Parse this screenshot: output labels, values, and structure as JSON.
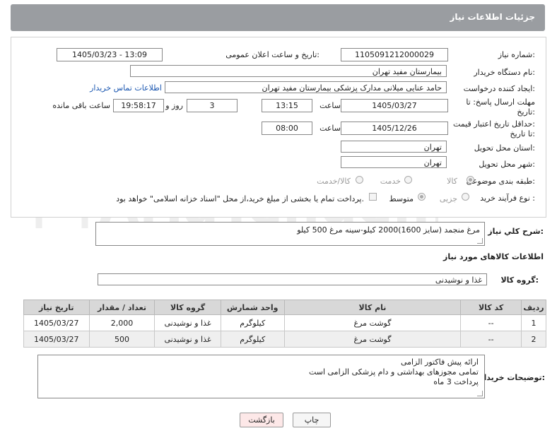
{
  "header": {
    "title": "جزئیات اطلاعات نیاز"
  },
  "form": {
    "need_number_label": "شماره نیاز:",
    "need_number": "1105091212000029",
    "announce_label": "تاریخ و ساعت اعلان عمومی:",
    "announce_value": "1405/03/23 - 13:09",
    "buyer_org_label": "نام دستگاه خریدار:",
    "buyer_org": "بیمارستان مفید تهران",
    "creator_label": "ایجاد کننده درخواست:",
    "creator": "حامد عنایی میلانی مدارک پزشکی بیمارستان مفید تهران",
    "contact_link": "اطلاعات تماس خریدار",
    "deadline_label_1": "مهلت ارسال پاسخ: تا",
    "deadline_label_2": "تاریخ:",
    "deadline_date": "1405/03/27",
    "hour_label": "ساعت",
    "deadline_time": "13:15",
    "days_value": "3",
    "days_label": "روز و",
    "remaining_time": "19:58:17",
    "remaining_label": "ساعت باقی مانده",
    "validity_label_1": "حداقل تاریخ اعتبار قیمت:",
    "validity_label_2": "تا تاریخ:",
    "validity_date": "1405/12/26",
    "validity_time": "08:00",
    "province_label": "استان محل تحویل:",
    "province": "تهران",
    "city_label": "شهر محل تحویل:",
    "city": "تهران",
    "category_label": "طبقه بندی موضوعی:",
    "category_options": [
      "کالا",
      "خدمت",
      "کالا/خدمت"
    ],
    "process_label": "نوع فرآیند خرید :",
    "process_options": [
      "جزیی",
      "متوسط"
    ],
    "payment_note": "پرداخت تمام یا بخشی از مبلغ خرید،از محل \"اسناد خزانه اسلامی\" خواهد بود."
  },
  "description": {
    "label": "شرح کلي نياز:",
    "text": "مرغ منجمد  (سایز 1600)2000 کیلو-سینه مرغ 500 کیلو"
  },
  "goods": {
    "section_title": "اطلاعات کالاهای مورد نیاز",
    "group_label": "گروه کالا:",
    "group_value": "غذا و نوشیدنی"
  },
  "table": {
    "headers": [
      "ردیف",
      "کد کالا",
      "نام کالا",
      "واحد شمارش",
      "گروه کالا",
      "تعداد / مقدار",
      "تاریخ نیاز"
    ],
    "rows": [
      [
        "1",
        "--",
        "گوشت مرغ",
        "کیلوگرم",
        "غذا و نوشیدنی",
        "2,000",
        "1405/03/27"
      ],
      [
        "2",
        "--",
        "گوشت مرغ",
        "کیلوگرم",
        "غذا و نوشیدنی",
        "500",
        "1405/03/27"
      ]
    ]
  },
  "buyer_notes": {
    "label": "توضیحات خریدار:",
    "lines": [
      "ارائه پیش فاکتور الزامی",
      "تمامی مجوزهای بهداشتی و دام پزشکی الزامی است",
      "پرداخت 3 ماه"
    ]
  },
  "buttons": {
    "print": "چاپ",
    "back": "بازگشت"
  },
  "colors": {
    "header_bg": "#9a9da1",
    "link": "#1a56b0",
    "back_button_bg": "#fde8e8"
  }
}
